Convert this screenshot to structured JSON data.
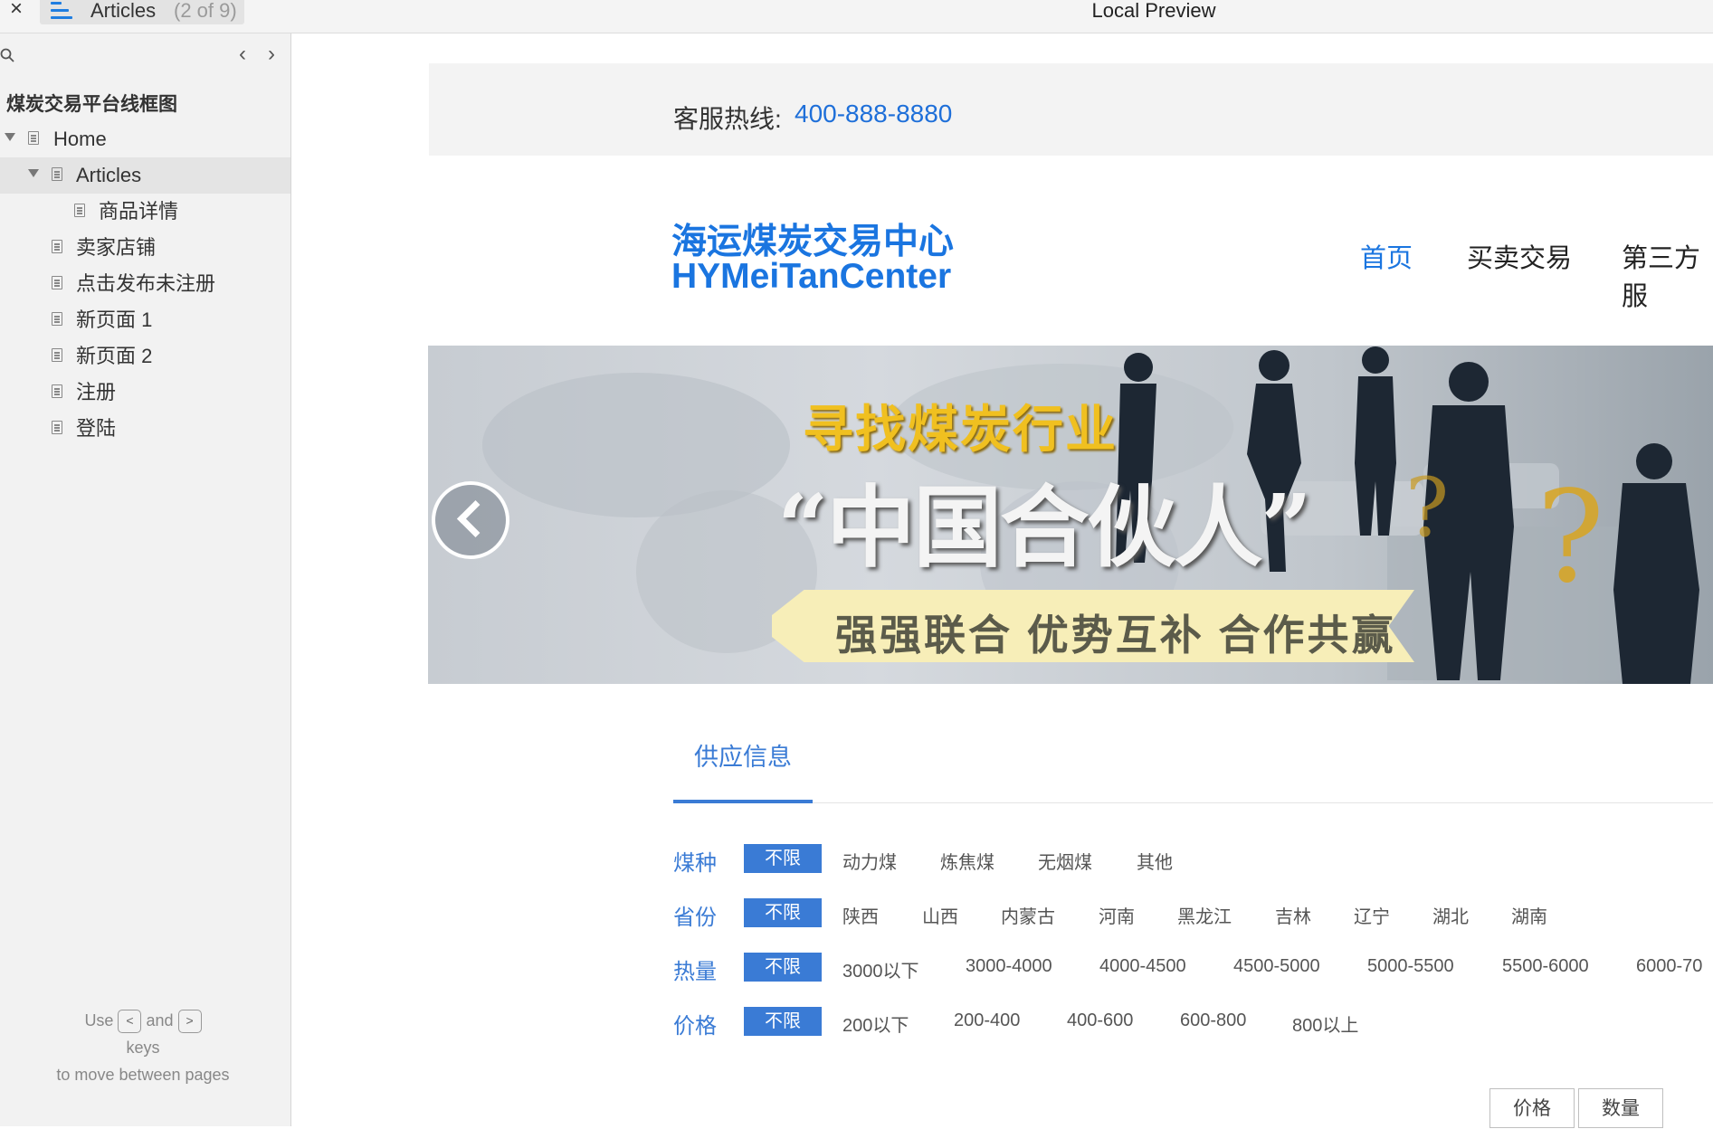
{
  "app": {
    "tab_title": "Articles",
    "tab_count": "(2 of 9)",
    "preview_title": "Local Preview"
  },
  "sidebar": {
    "project_title": "煤炭交易平台线框图",
    "items": [
      {
        "label": "Home"
      },
      {
        "label": "Articles"
      },
      {
        "label": "商品详情"
      },
      {
        "label": "卖家店铺"
      },
      {
        "label": "点击发布未注册"
      },
      {
        "label": "新页面 1"
      },
      {
        "label": "新页面 2"
      },
      {
        "label": "注册"
      },
      {
        "label": "登陆"
      }
    ],
    "hint": {
      "use": "Use",
      "and": "and",
      "keys": "keys",
      "rest": "to move between pages",
      "key_left": "<",
      "key_right": ">"
    }
  },
  "page": {
    "hotline_label": "客服热线:",
    "hotline_number": "400-888-8880",
    "brand_cn": "海运煤炭交易中心",
    "brand_en": "HYMeiTanCenter",
    "nav": [
      "首页",
      "买卖交易",
      "第三方服"
    ],
    "banner": {
      "line1": "寻找煤炭行业",
      "line2": "“中国合伙人”",
      "line3": "强强联合 优势互补 合作共赢"
    },
    "supply_tab": "供应信息",
    "filters": [
      {
        "label": "煤种",
        "all": "不限",
        "options": [
          "动力煤",
          "炼焦煤",
          "无烟煤",
          "其他"
        ]
      },
      {
        "label": "省份",
        "all": "不限",
        "options": [
          "陕西",
          "山西",
          "内蒙古",
          "河南",
          "黑龙江",
          "吉林",
          "辽宁",
          "湖北",
          "湖南"
        ]
      },
      {
        "label": "热量",
        "all": "不限",
        "options": [
          "3000以下",
          "3000-4000",
          "4000-4500",
          "4500-5000",
          "5000-5500",
          "5500-6000",
          "6000-70"
        ]
      },
      {
        "label": "价格",
        "all": "不限",
        "options": [
          "200以下",
          "200-400",
          "400-600",
          "600-800",
          "800以上"
        ]
      }
    ],
    "sort_buttons": [
      "价格",
      "数量"
    ]
  },
  "colors": {
    "accent": "#1a75e0",
    "filter_blue": "#3a7bd5",
    "sidebar_bg": "#f2f2f2",
    "banner_gold": "#f0c020"
  }
}
